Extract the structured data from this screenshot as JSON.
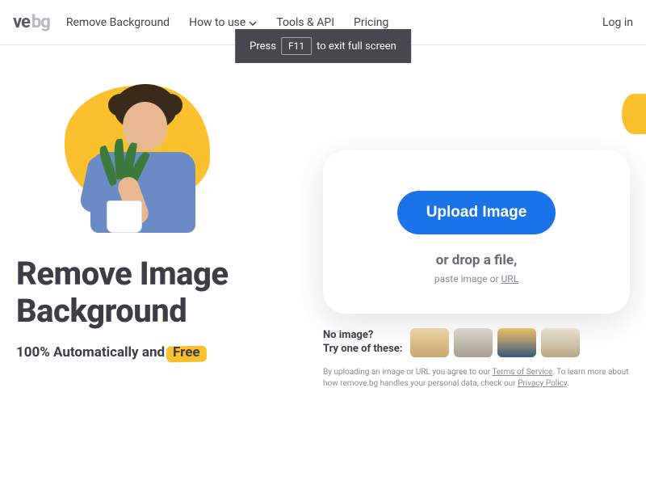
{
  "logo": {
    "part1": "ve",
    "part2": "bg"
  },
  "nav": {
    "remove_bg": "Remove Background",
    "how_to_use": "How to use",
    "tools_api": "Tools & API",
    "pricing": "Pricing",
    "login": "Log in"
  },
  "fullscreen": {
    "press": "Press",
    "key": "F11",
    "exit": "to exit full screen"
  },
  "hero": {
    "headline_l1": "Remove Image",
    "headline_l2": "Background",
    "sub_prefix": "100% Automatically and",
    "sub_free": "Free"
  },
  "upload": {
    "button": "Upload Image",
    "drop": "or drop a file,",
    "paste_prefix": "paste image or ",
    "url": "URL"
  },
  "samples": {
    "line1": "No image?",
    "line2": "Try one of these:"
  },
  "legal": {
    "t1": "By uploading an image or URL you agree to our ",
    "tos": "Terms of Service",
    "t2": ". To learn more about how remove.bg handles your personal data, check our ",
    "pp": "Privacy Policy",
    "t3": "."
  }
}
